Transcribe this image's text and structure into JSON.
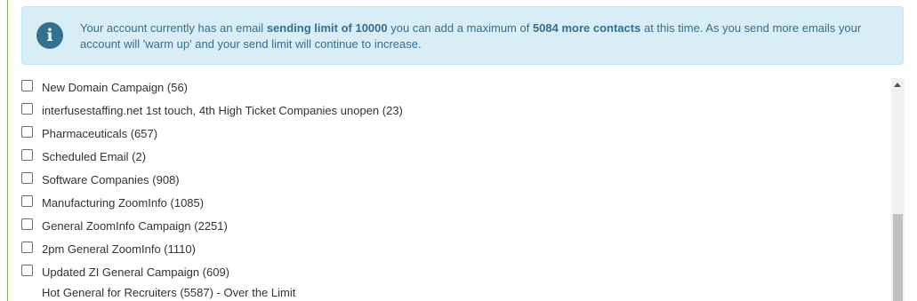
{
  "info": {
    "text_1": "Your account currently has an email ",
    "bold_1": "sending limit of 10000",
    "text_2": " you can add a maximum of ",
    "bold_2": "5084 more contacts",
    "text_3": " at this time. As you send more emails your account will 'warm up' and your send limit will continue to increase.",
    "icon": "info-icon"
  },
  "lists": [
    {
      "label": "New Domain Campaign (56)",
      "checked": false
    },
    {
      "label": "interfusestaffing.net 1st touch, 4th High Ticket Companies unopen (23)",
      "checked": false
    },
    {
      "label": "Pharmaceuticals (657)",
      "checked": false
    },
    {
      "label": "Scheduled Email (2)",
      "checked": false
    },
    {
      "label": "Software Companies (908)",
      "checked": false
    },
    {
      "label": "Manufacturing ZoomInfo (1085)",
      "checked": false
    },
    {
      "label": "General ZoomInfo Campaign (2251)",
      "checked": false
    },
    {
      "label": "2pm General ZoomInfo (1110)",
      "checked": false
    },
    {
      "label": "Updated ZI General Campaign (609)",
      "checked": false
    }
  ],
  "over_limit_item": {
    "label": "Hot General for Recruiters (5587) - Over the Limit"
  },
  "colors": {
    "info_bg": "#d9edf7",
    "info_text": "#31708f",
    "accent_border": "#7cbf5a"
  }
}
